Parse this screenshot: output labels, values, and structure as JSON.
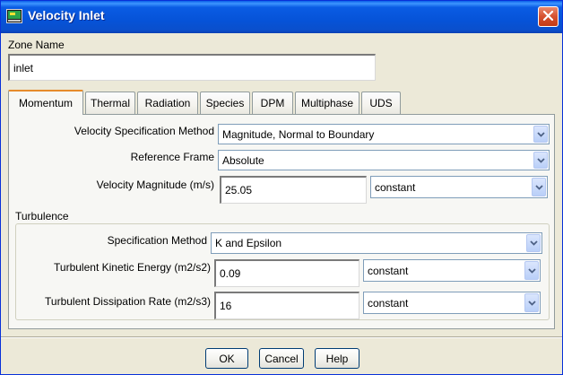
{
  "window": {
    "title": "Velocity Inlet",
    "accent": "#0a5ce4"
  },
  "zone": {
    "label": "Zone Name",
    "value": "inlet"
  },
  "tabs": [
    {
      "label": "Momentum",
      "active": true
    },
    {
      "label": "Thermal",
      "active": false
    },
    {
      "label": "Radiation",
      "active": false
    },
    {
      "label": "Species",
      "active": false
    },
    {
      "label": "DPM",
      "active": false
    },
    {
      "label": "Multiphase",
      "active": false
    },
    {
      "label": "UDS",
      "active": false
    }
  ],
  "momentum": {
    "velocity_spec_label": "Velocity Specification Method",
    "velocity_spec_value": "Magnitude, Normal to Boundary",
    "reference_frame_label": "Reference Frame",
    "reference_frame_value": "Absolute",
    "velocity_magnitude_label": "Velocity Magnitude (m/s)",
    "velocity_magnitude_value": "25.05",
    "velocity_magnitude_profile": "constant"
  },
  "turbulence": {
    "group_label": "Turbulence",
    "spec_method_label": "Specification Method",
    "spec_method_value": "K and Epsilon",
    "tke_label": "Turbulent Kinetic Energy (m2/s2)",
    "tke_value": "0.09",
    "tke_profile": "constant",
    "tdr_label": "Turbulent Dissipation Rate (m2/s3)",
    "tdr_value": "16",
    "tdr_profile": "constant"
  },
  "buttons": {
    "ok": "OK",
    "cancel": "Cancel",
    "help": "Help"
  },
  "icons": {
    "title": "fluent-app-icon",
    "close": "close-icon",
    "dropdown": "chevron-down-icon"
  }
}
